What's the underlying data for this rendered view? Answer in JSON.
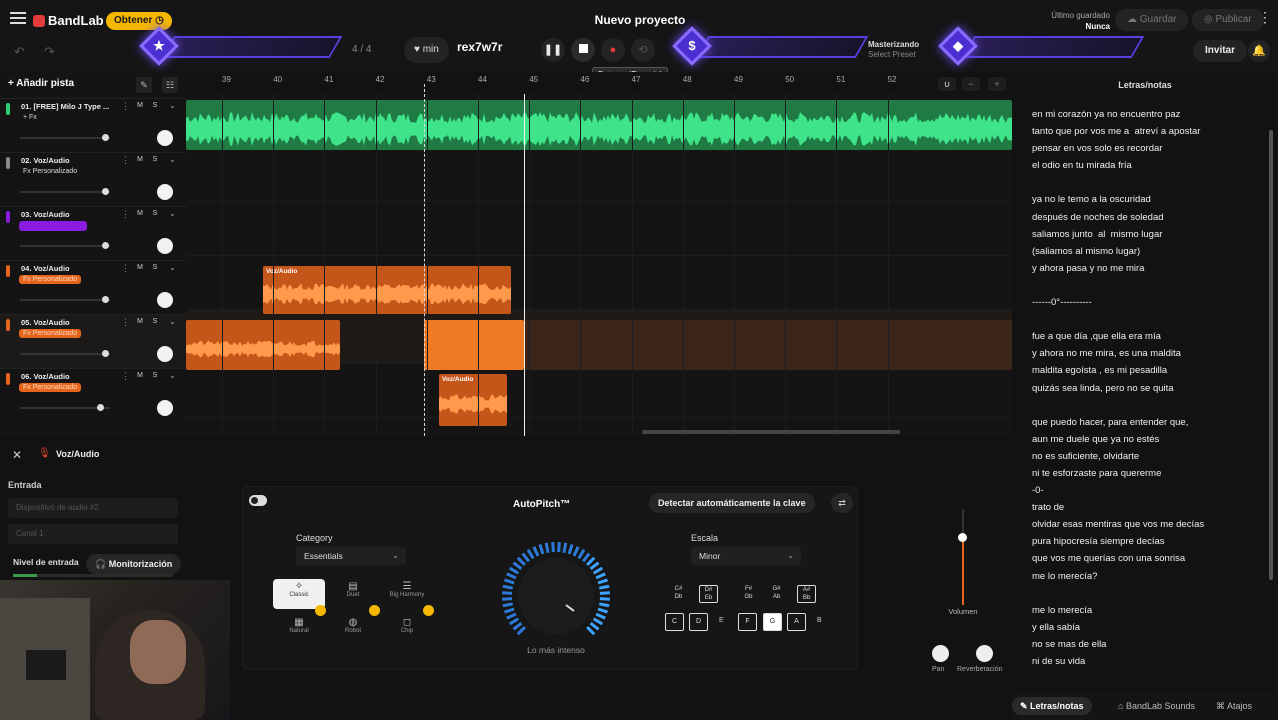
{
  "topbar": {
    "brand": "BandLab",
    "get_label": "Obtener",
    "project_title": "Nuevo proyecto",
    "saved_label": "Último guardado",
    "saved_value": "Nunca",
    "save_label": "Guardar",
    "publish_label": "Publicar",
    "invite_label": "Invitar",
    "time_signature": "4 / 4",
    "tempo_unit": "min",
    "key_text": "rex7w7r",
    "stop_tooltip": "Detener (Espacio)",
    "mastering_label": "Masterizando",
    "mastering_sub": "Select Preset"
  },
  "overlay": {
    "star_icon": "★",
    "dollar_icon": "$",
    "diamond_icon": "◆"
  },
  "tracks_header": {
    "add_track": "Añadir pista"
  },
  "tracks": [
    {
      "name": "01. [FREE] Milo J Type ...",
      "fx": "+ Fx",
      "fx_style": "plain",
      "color": "#2ecc71",
      "mute": "M",
      "solo": "S",
      "volume": 0.95
    },
    {
      "name": "02. Voz/Audio",
      "fx": "Fx Personalizado",
      "fx_style": "plain",
      "color": "#888888",
      "mute": "M",
      "solo": "S",
      "volume": 0.95
    },
    {
      "name": "03. Voz/Audio",
      "fx": "",
      "fx_style": "purple",
      "color": "#8a1be0",
      "mute": "M",
      "solo": "S",
      "volume": 0.95
    },
    {
      "name": "04. Voz/Audio",
      "fx": "Fx Personalizado",
      "fx_style": "orange",
      "color": "#e5651c",
      "mute": "M",
      "solo": "S",
      "volume": 0.95
    },
    {
      "name": "05. Voz/Audio",
      "fx": "Fx Personalizado",
      "fx_style": "orange",
      "color": "#e5651c",
      "mute": "M",
      "solo": "S",
      "volume": 0.95
    },
    {
      "name": "06. Voz/Audio",
      "fx": "Fx Personalizado",
      "fx_style": "orange",
      "color": "#e5651c",
      "mute": "M",
      "solo": "S",
      "volume": 0.9
    }
  ],
  "ruler_marks": [
    "39",
    "40",
    "41",
    "42",
    "43",
    "44",
    "45",
    "46",
    "47",
    "48",
    "49",
    "50",
    "51",
    "52"
  ],
  "clips": {
    "clip4_name": "Voz/Audio",
    "clip6_name": "Voz/Audio"
  },
  "lyrics": {
    "title": "Letras/notas",
    "text": "en mi corazón ya no encuentro paz\ntanto que por vos me a  atreví a apostar\npensar en vos solo es recordar\nel odio en tu mirada fría\n\nya no le temo a la oscuridad\ndespués de noches de soledad\nsaliamos junto  al  mismo lugar\n(saliamos al mismo lugar)\ny ahora pasa y no me mira\n\n------0°----------\n\nfue a que día ,que ella era mía\ny ahora no me mira, es una maldita\nmaldita egoísta , es mi pesadilla\nquizás sea linda, pero no se quita\n\nque puedo hacer, para entender que,\naun me duele que ya no estés\nno es suficiente, olvidarte\nni te esforzaste para quererme\n-0-\ntrato de\nolvidar esas mentiras que vos me decías\npura hipocresía siempre decías\nque vos me querías con una sonrisa\nme lo merecía?\n\nme lo merecía\ny ella sabía\nno se mas de ella\nni de su vida"
  },
  "bottom_tabs": {
    "lyrics": "Letras/notas",
    "sounds": "BandLab Sounds",
    "shortcuts": "Atajos"
  },
  "editor": {
    "title": "Voz/Audio",
    "input_label": "Entrada",
    "device": "Dispositivo de audio #2",
    "channel": "Canal 1",
    "level_label": "Nivel de entrada",
    "level_value": 0.15,
    "monitor_label": "Monitorización"
  },
  "autopitch": {
    "title": "AutoPitch™",
    "detect_label": "Detectar automáticamente la clave",
    "category_label": "Category",
    "category_value": "Essentials",
    "scale_label": "Escala",
    "scale_value": "Minor",
    "knob_label": "Lo más intenso",
    "presets": [
      {
        "name": "Classic",
        "icon": "✧"
      },
      {
        "name": "Duet",
        "icon": "▤"
      },
      {
        "name": "Big Harmony",
        "icon": "☰"
      },
      {
        "name": "Natural",
        "icon": "▦"
      },
      {
        "name": "Robot",
        "icon": "◍"
      },
      {
        "name": "Chip",
        "icon": "◻"
      }
    ],
    "keys_top": [
      "C#\nDb",
      "D#\nEb",
      "F#\nGb",
      "G#\nAb",
      "A#\nBb"
    ],
    "keys_bottom": [
      "C",
      "D",
      "E",
      "F",
      "G",
      "A",
      "B"
    ]
  },
  "mixer": {
    "volume_label": "Volumen",
    "pan_label": "Pan",
    "reverb_label": "Reverberación"
  }
}
